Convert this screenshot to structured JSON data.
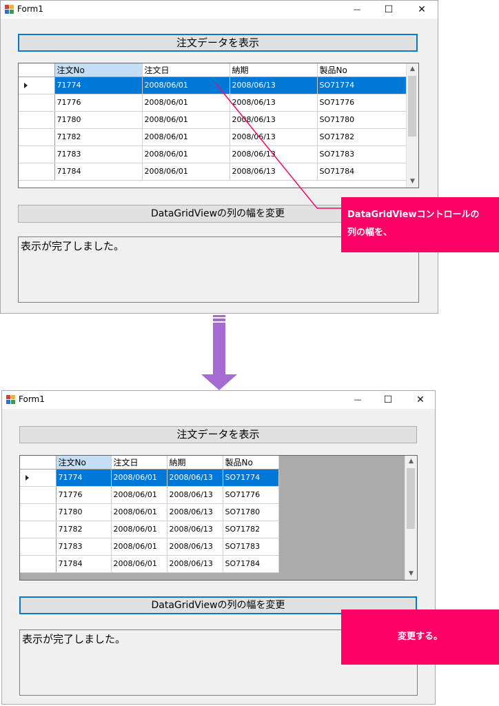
{
  "before": {
    "window_title": "Form1",
    "show_button_label": "注文データを表示",
    "resize_button_label": "DataGridViewの列の幅を変更",
    "columns": [
      "注文No",
      "注文日",
      "納期",
      "製品No"
    ],
    "rows": [
      [
        "71774",
        "2008/06/01",
        "2008/06/13",
        "SO71774"
      ],
      [
        "71776",
        "2008/06/01",
        "2008/06/13",
        "SO71776"
      ],
      [
        "71780",
        "2008/06/01",
        "2008/06/13",
        "SO71780"
      ],
      [
        "71782",
        "2008/06/01",
        "2008/06/13",
        "SO71782"
      ],
      [
        "71783",
        "2008/06/01",
        "2008/06/13",
        "SO71783"
      ],
      [
        "71784",
        "2008/06/01",
        "2008/06/13",
        "SO71784"
      ]
    ],
    "status_text": "表示が完了しました。",
    "callout_line1": "DataGridViewコントロールの",
    "callout_line2": "列の幅を、"
  },
  "after": {
    "window_title": "Form1",
    "show_button_label": "注文データを表示",
    "resize_button_label": "DataGridViewの列の幅を変更",
    "columns": [
      "注文No",
      "注文日",
      "納期",
      "製品No"
    ],
    "rows": [
      [
        "71774",
        "2008/06/01",
        "2008/06/13",
        "SO71774"
      ],
      [
        "71776",
        "2008/06/01",
        "2008/06/13",
        "SO71776"
      ],
      [
        "71780",
        "2008/06/01",
        "2008/06/13",
        "SO71780"
      ],
      [
        "71782",
        "2008/06/01",
        "2008/06/13",
        "SO71782"
      ],
      [
        "71783",
        "2008/06/01",
        "2008/06/13",
        "SO71783"
      ],
      [
        "71784",
        "2008/06/01",
        "2008/06/13",
        "SO71784"
      ]
    ],
    "status_text": "表示が完了しました。",
    "callout_text": "変更する。"
  },
  "caption_buttons": {
    "minimize": "—",
    "maximize": "☐",
    "close": "✕"
  },
  "colors": {
    "selection": "#0078d7",
    "callout": "#ff0066",
    "arrow": "#a66bd3"
  },
  "icons": [
    "app-icon",
    "minimize-icon",
    "maximize-icon",
    "close-icon",
    "row-pointer-icon",
    "scroll-up-icon",
    "scroll-down-icon",
    "down-arrow-icon"
  ]
}
